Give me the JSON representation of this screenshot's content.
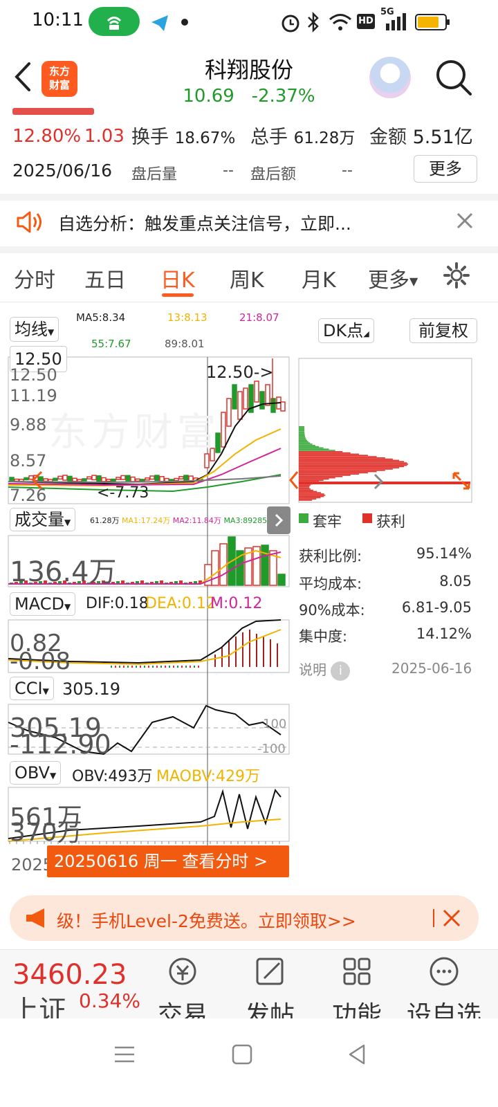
{
  "status_bar": {
    "time": "10:11",
    "hd": "HD",
    "net": "5G",
    "accent": "#21b04b"
  },
  "header": {
    "logo_line1": "东方",
    "logo_line2": "财富",
    "stock_name": "科翔股份",
    "price": "10.69",
    "change_pct": "-2.37%"
  },
  "quote": {
    "amplitude": "12.80%",
    "volume_ratio": "1.03",
    "turnover_label": "换手",
    "turnover": "18.67%",
    "total_hands_label": "总手",
    "total_hands": "61.28万",
    "amount_label": "金额",
    "amount": "5.51亿",
    "date": "2025/06/16",
    "after_vol_label": "盘后量",
    "after_vol": "--",
    "after_amt_label": "盘后额",
    "after_amt": "--",
    "more_btn": "更多"
  },
  "notice": {
    "text": "自选分析：触发重点关注信号，立即..."
  },
  "tabs": {
    "t1": "分时",
    "t2": "五日",
    "t3": "日K",
    "t4": "周K",
    "t5": "月K",
    "t6": "更多",
    "active": "日K"
  },
  "kline": {
    "avg_btn": "均线",
    "ma5": "MA5:8.34",
    "ma13": "13:8.13",
    "ma21": "21:8.07",
    "ma55": "55:7.67",
    "ma89": "89:8.01",
    "dk_btn": "DK点",
    "fq_btn": "前复权",
    "cursor_price": "12.50",
    "y_ticks": [
      "12.50",
      "11.19",
      "9.88",
      "8.57",
      "7.26"
    ],
    "high_marker": "12.50->",
    "low_marker": "<-7.73",
    "colors": {
      "up": "#e0302a",
      "down": "#1f9a2b",
      "ma5": "#111111",
      "ma13": "#f0b400",
      "ma21": "#d0259a",
      "ma55": "#1f9a2b",
      "ma89": "#777777"
    }
  },
  "volume": {
    "name": "成交量",
    "vol": "61.28万",
    "ma1": "MA1:17.24万",
    "ma2": "MA2:11.84万",
    "ma3": "MA3:89285",
    "top_label": "136.4万"
  },
  "macd": {
    "name": "MACD",
    "dif": "DIF:0.18",
    "dea": "DEA:0.12",
    "m": "M:0.12",
    "top": "0.82",
    "bottom": "-0.08"
  },
  "cci": {
    "name": "CCI",
    "value": "305.19",
    "top": "305.19",
    "bottom": "-112.90",
    "ref_hi": "100",
    "ref_lo": "-100"
  },
  "obv": {
    "name": "OBV",
    "obv": "OBV:493万",
    "maobv": "MAOBV:429万",
    "top": "561万",
    "bottom": "370万"
  },
  "chips": {
    "legend_trapped": "套牢",
    "legend_profit": "获利",
    "rows": [
      {
        "label": "获利比例:",
        "value": "95.14%"
      },
      {
        "label": "平均成本:",
        "value": "8.05"
      },
      {
        "label": "90%成本:",
        "value": "6.81-9.05"
      },
      {
        "label": "集中度:",
        "value": "14.12%"
      }
    ],
    "note": "说明",
    "date": "2025-06-16"
  },
  "date_banner": {
    "prefix": "2025",
    "text": "20250616 周一 查看分时 >"
  },
  "l2_banner": {
    "text": "级！手机Level-2免费送。立即领取>>"
  },
  "bottom_nav": {
    "index_value": "3460.23",
    "index_name": "上证",
    "index_change": "0.34%",
    "items": [
      "交易",
      "发帖",
      "功能",
      "设自选"
    ]
  }
}
